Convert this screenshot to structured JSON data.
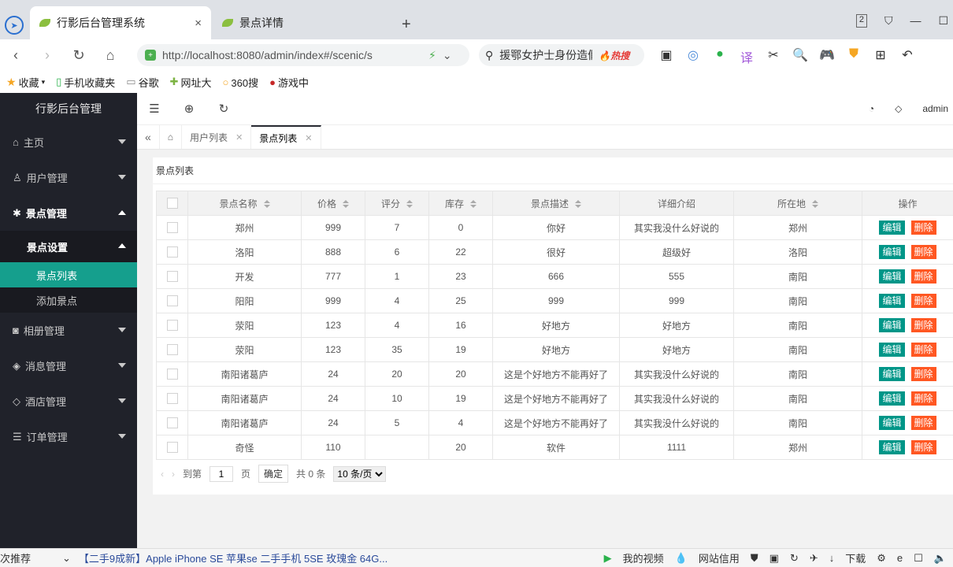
{
  "browser": {
    "tabs": [
      {
        "title": "行影后台管理系统",
        "close": "×"
      },
      {
        "title": "景点详情"
      }
    ],
    "new_tab": "+",
    "url": "http://localhost:8080/admin/index#/scenic/s",
    "search": {
      "text": "援鄂女护士身份造假",
      "badge": "🔥热搜"
    },
    "bookmarks": [
      {
        "label": "收藏",
        "icon": "star-icon"
      },
      {
        "label": "手机收藏夹",
        "icon": "phone-icon"
      },
      {
        "label": "谷歌",
        "icon": "page-icon"
      },
      {
        "label": "网址大",
        "icon": "site-icon"
      },
      {
        "label": "360搜",
        "icon": "search-icon"
      },
      {
        "label": "游戏中",
        "icon": "game-icon"
      }
    ],
    "window_badge": "2"
  },
  "sidebar": {
    "title": "行影后台管理",
    "items": [
      {
        "label": "主页",
        "icon": "home-icon"
      },
      {
        "label": "用户管理",
        "icon": "user-icon"
      },
      {
        "label": "景点管理",
        "icon": "scenic-icon"
      },
      {
        "label": "相册管理",
        "icon": "camera-icon"
      },
      {
        "label": "消息管理",
        "icon": "message-icon"
      },
      {
        "label": "酒店管理",
        "icon": "diamond-icon"
      },
      {
        "label": "订单管理",
        "icon": "list-icon"
      }
    ],
    "submenu": {
      "label": "景点设置",
      "children": [
        {
          "label": "景点列表"
        },
        {
          "label": "添加景点"
        }
      ]
    }
  },
  "topbar": {
    "user": "admin"
  },
  "page_tabs": [
    {
      "label": "用户列表"
    },
    {
      "label": "景点列表"
    }
  ],
  "panel": {
    "title": "景点列表",
    "columns": [
      "景点名称",
      "价格",
      "评分",
      "库存",
      "景点描述",
      "详细介绍",
      "所在地",
      "操作"
    ],
    "rows": [
      [
        "郑州",
        "999",
        "7",
        "0",
        "你好",
        "其实我没什么好说的",
        "郑州"
      ],
      [
        "洛阳",
        "888",
        "6",
        "22",
        "很好",
        "超级好",
        "洛阳"
      ],
      [
        "开发",
        "777",
        "1",
        "23",
        "666",
        "555",
        "南阳"
      ],
      [
        "阳阳",
        "999",
        "4",
        "25",
        "999",
        "999",
        "南阳"
      ],
      [
        "荥阳",
        "123",
        "4",
        "16",
        "好地方",
        "好地方",
        "南阳"
      ],
      [
        "荥阳",
        "123",
        "35",
        "19",
        "好地方",
        "好地方",
        "南阳"
      ],
      [
        "南阳诸葛庐",
        "24",
        "20",
        "20",
        "这是个好地方不能再好了",
        "其实我没什么好说的",
        "南阳"
      ],
      [
        "南阳诸葛庐",
        "24",
        "10",
        "19",
        "这是个好地方不能再好了",
        "其实我没什么好说的",
        "南阳"
      ],
      [
        "南阳诸葛庐",
        "24",
        "5",
        "4",
        "这是个好地方不能再好了",
        "其实我没什么好说的",
        "南阳"
      ],
      [
        "奇怪",
        "110",
        "",
        "20",
        "软件",
        "1111",
        "郑州"
      ]
    ],
    "edit_label": "编辑",
    "delete_label": "删除",
    "pager": {
      "goto": "到第",
      "page_value": "1",
      "page_unit": "页",
      "confirm": "确定",
      "total": "共 0 条",
      "page_size": "10 条/页"
    }
  },
  "statusbar": {
    "left": "次推荐",
    "news": "【二手9成新】Apple iPhone SE 苹果se 二手手机 5SE 玫瑰金 64G...",
    "video": "我的视频",
    "credit": "网站信用",
    "download": "下载"
  }
}
